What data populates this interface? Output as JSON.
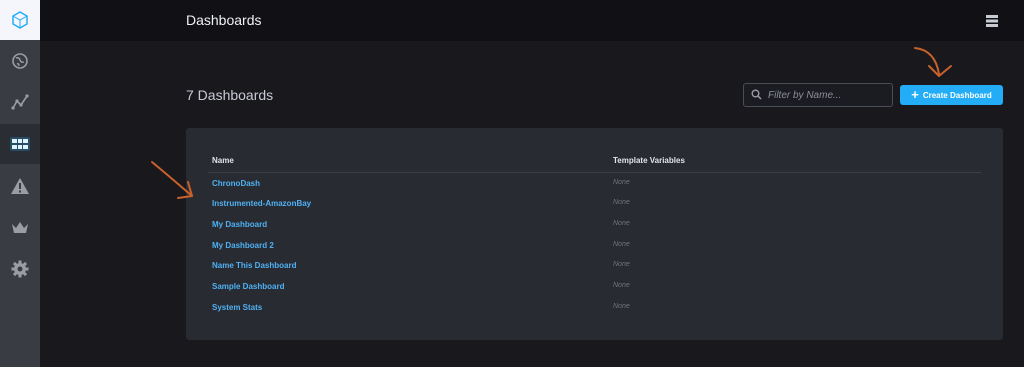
{
  "header": {
    "title": "Dashboards"
  },
  "main": {
    "count_label": "7 Dashboards",
    "filter": {
      "placeholder": "Filter by Name..."
    },
    "create_button": {
      "label": "Create Dashboard"
    },
    "table": {
      "columns": [
        "Name",
        "Template Variables"
      ],
      "rows": [
        {
          "name": "ChronoDash",
          "vars": "None"
        },
        {
          "name": "Instrumented-AmazonBay",
          "vars": "None"
        },
        {
          "name": "My Dashboard",
          "vars": "None"
        },
        {
          "name": "My Dashboard 2",
          "vars": "None"
        },
        {
          "name": "Name This Dashboard",
          "vars": "None"
        },
        {
          "name": "Sample Dashboard",
          "vars": "None"
        },
        {
          "name": "System Stats",
          "vars": "None"
        }
      ]
    }
  },
  "sidebar": {
    "items": [
      {
        "icon": "logo-icon"
      },
      {
        "icon": "globe-icon"
      },
      {
        "icon": "graph-icon"
      },
      {
        "icon": "dashboard-grid-icon",
        "active": true
      },
      {
        "icon": "alert-triangle-icon"
      },
      {
        "icon": "crown-icon"
      },
      {
        "icon": "gear-icon"
      }
    ]
  },
  "colors": {
    "accent": "#22adf6",
    "link": "#4fb1f2",
    "annotation_arrow": "#c8622a",
    "sidebar": "#3a3c44",
    "panel": "#292b33"
  }
}
